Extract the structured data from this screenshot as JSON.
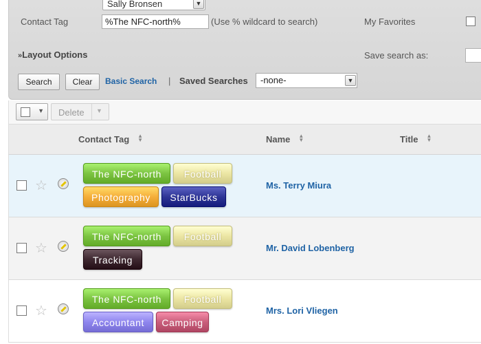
{
  "search": {
    "assigned_value": "Sally Bronsen",
    "contact_tag_label": "Contact Tag",
    "contact_tag_value": "%The NFC-north%",
    "contact_tag_hint": "(Use % wildcard to search)",
    "my_favorites_label": "My Favorites",
    "layout_options_label": "Layout Options",
    "save_search_label": "Save search as:",
    "search_button": "Search",
    "clear_button": "Clear",
    "basic_search_link": "Basic Search",
    "separator": "|",
    "saved_searches_label": "Saved Searches",
    "saved_searches_value": "-none-"
  },
  "actions": {
    "delete_label": "Delete"
  },
  "table": {
    "columns": [
      "Contact Tag",
      "Name",
      "Title"
    ],
    "rows": [
      {
        "name": "Ms. Terry Miura",
        "tags": [
          "The NFC-north",
          "Football",
          "Photography",
          "StarBucks"
        ]
      },
      {
        "name": "Mr. David Lobenberg",
        "tags": [
          "The NFC-north",
          "Football",
          "Tracking"
        ]
      },
      {
        "name": "Mrs. Lori Vliegen",
        "tags": [
          "The NFC-north",
          "Football",
          "Accountant",
          "Camping"
        ]
      }
    ]
  },
  "tag_colors": {
    "The NFC-north": "#7cc442",
    "Football": "#ece6a4",
    "Photography": "#f5ae3a",
    "StarBucks": "#2e3596",
    "Tracking": "#3e2830",
    "Accountant": "#8f86ee",
    "Camping": "#c95f7c"
  },
  "colors": {
    "link": "#1f63a5",
    "row_highlight": "#e8f4fb",
    "row_alt": "#f3f3f3"
  }
}
